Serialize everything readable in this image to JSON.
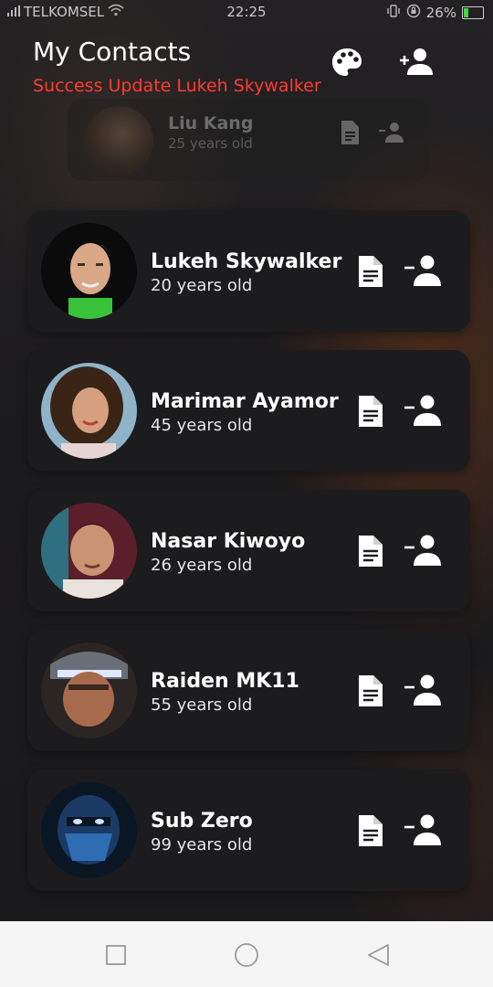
{
  "status_bar": {
    "carrier": "TELKOMSEL",
    "time": "22:25",
    "battery": "26%"
  },
  "header": {
    "title": "My Contacts",
    "update_message": "Success Update Lukeh Skywalker",
    "palette_icon": "palette-icon",
    "add_contact_icon": "add-person-icon"
  },
  "ghost_item": {
    "name": "Liu Kang",
    "age": "25 years old"
  },
  "contacts": [
    {
      "name": "Lukeh Skywalker",
      "age": "20 years old"
    },
    {
      "name": "Marimar Ayamor",
      "age": "45 years old"
    },
    {
      "name": "Nasar Kiwoyo",
      "age": "26 years old"
    },
    {
      "name": "Raiden MK11",
      "age": "55 years old"
    },
    {
      "name": "Sub Zero",
      "age": "99 years old"
    }
  ],
  "colors": {
    "accent_error": "#ff3b30",
    "card_bg": "#1c1b1d",
    "text_primary": "#ffffff"
  }
}
